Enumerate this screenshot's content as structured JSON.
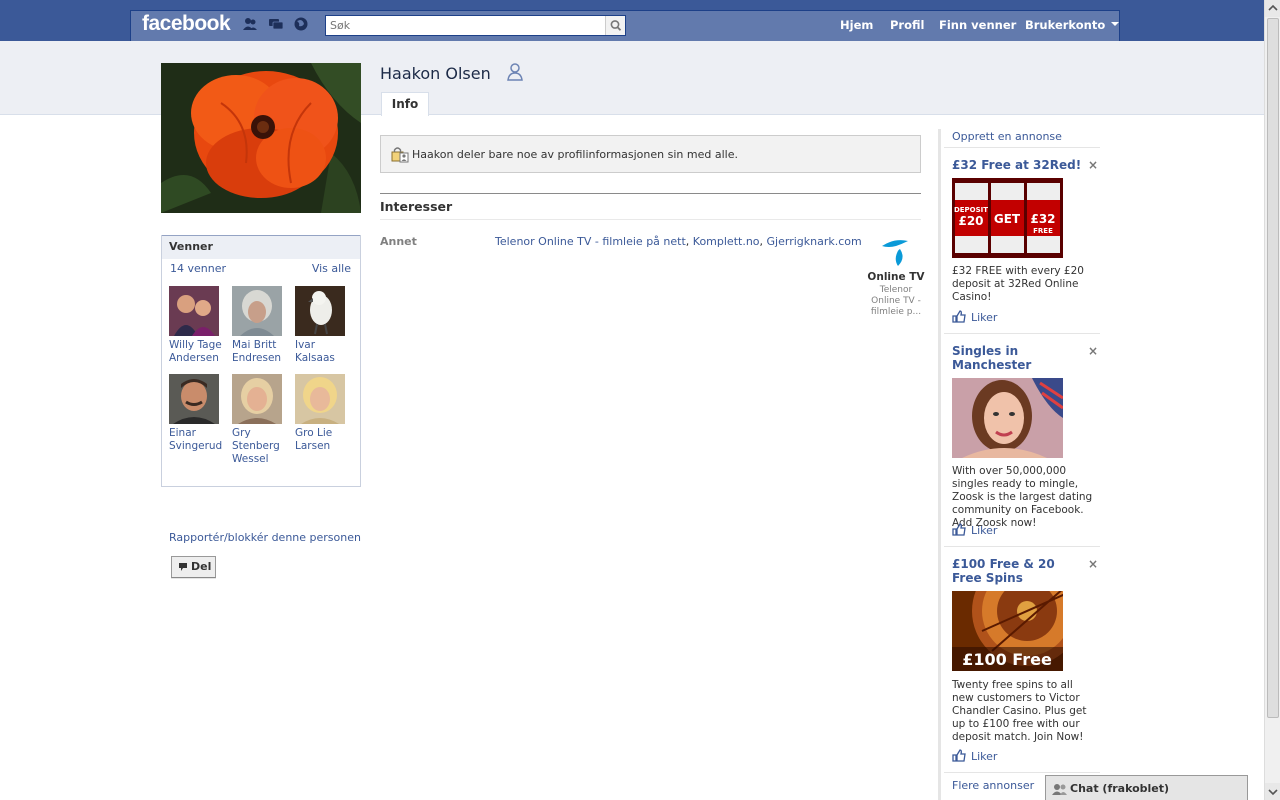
{
  "header": {
    "logo": "facebook",
    "search_placeholder": "Søk",
    "nav": [
      "Hjem",
      "Profil",
      "Finn venner",
      "Brukerkonto"
    ],
    "color": "#3b5998"
  },
  "profile": {
    "name": "Haakon Olsen",
    "tab": "Info"
  },
  "friends": {
    "title": "Venner",
    "count": "14 venner",
    "see_all": "Vis alle",
    "items": [
      {
        "name": "Willy Tage Andersen"
      },
      {
        "name": "Mai Britt Endresen"
      },
      {
        "name": "Ivar Kalsaas"
      },
      {
        "name": "Einar Svingerud"
      },
      {
        "name": "Gry Stenberg Wessel"
      },
      {
        "name": "Gro Lie Larsen"
      }
    ]
  },
  "actions": {
    "report": "Rapportér/blokkér denne personen",
    "share": "Del"
  },
  "main": {
    "privacy_notice": "Haakon deler bare noe av profilinformasjonen sin med alle.",
    "interests_title": "Interesser",
    "other_label": "Annet",
    "other_links": [
      "Telenor Online TV - filmleie på nett",
      "Komplett.no",
      "Gjerrigknark.com"
    ],
    "separator": ", ",
    "page_card": {
      "name": "Online TV",
      "desc": "Telenor Online TV - filmleie p..."
    }
  },
  "ads": {
    "create": "Opprett en annonse",
    "items": [
      {
        "title": "£32 Free at 32Red!",
        "body": "£32 FREE with every £20 deposit at 32Red Online Casino!",
        "like": "Liker",
        "img_labels": [
          "DEPOSIT",
          "£20",
          "GET",
          "£32",
          "FREE"
        ]
      },
      {
        "title": "Singles in Manchester",
        "body": "With over 50,000,000 singles ready to mingle, Zoosk is the largest dating community on Facebook. Add Zoosk now!",
        "like": "Liker"
      },
      {
        "title": "£100 Free & 20 Free Spins",
        "body": "Twenty free spins to all new customers to Victor Chandler Casino. Plus get up to £100 free with our deposit match. Join Now!",
        "like": "Liker",
        "img_label": "£100 Free"
      }
    ],
    "more": "Flere annonser"
  },
  "chat": {
    "label": "Chat (frakoblet)"
  }
}
